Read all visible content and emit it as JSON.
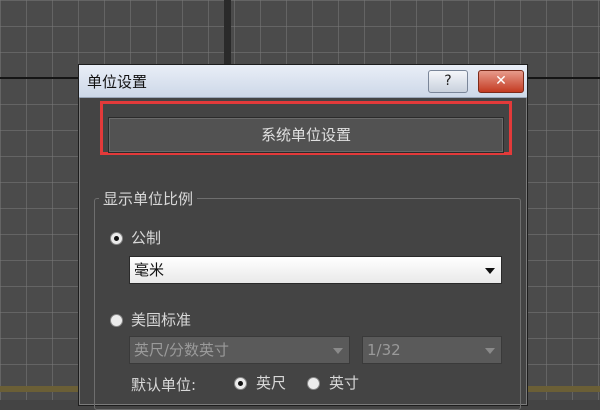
{
  "dialog": {
    "title": "单位设置",
    "help_label": "?",
    "close_label": "✕",
    "system_units_button": "系统单位设置",
    "display_group": {
      "title": "显示单位比例",
      "metric": {
        "label": "公制",
        "selected": true,
        "dropdown_value": "毫米"
      },
      "us_standard": {
        "label": "美国标准",
        "selected": false,
        "unit_dropdown_value": "英尺/分数英寸",
        "fraction_dropdown_value": "1/32",
        "default_unit_label": "默认单位:",
        "feet_label": "英尺",
        "inches_label": "英寸",
        "default_unit_selected": "英尺"
      }
    }
  },
  "colors": {
    "highlight": "#e33a3a",
    "dialog_bg": "#444444",
    "viewport_bg": "#4b4b4b"
  }
}
